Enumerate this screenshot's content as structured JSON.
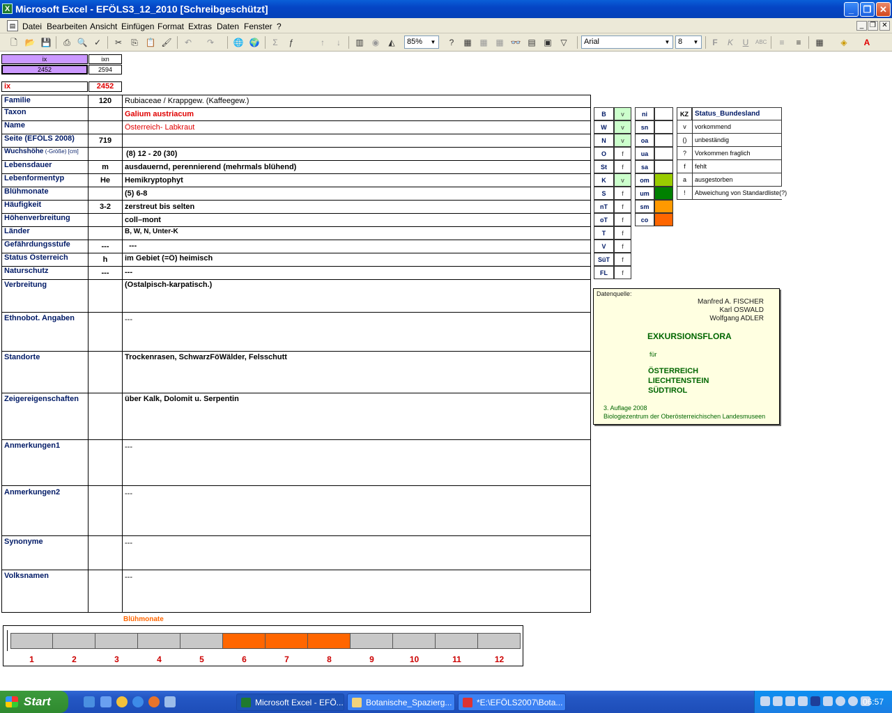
{
  "window": {
    "title": "Microsoft Excel - EFÖLS3_12_2010  [Schreibgeschützt]"
  },
  "menu": [
    "Datei",
    "Bearbeiten",
    "Ansicht",
    "Einfügen",
    "Format",
    "Extras",
    "Daten",
    "Fenster",
    "?"
  ],
  "toolbar": {
    "zoom": "85%",
    "font": "Arial",
    "size": "8"
  },
  "header_cells": {
    "ix_label": "ix",
    "ixn_label": "ixn",
    "ix_value": "2452",
    "ixn_value": "2594",
    "ix_big_label": "ix",
    "ix_big_value": "2452"
  },
  "rows": {
    "familie": {
      "label": "Familie",
      "code": "120",
      "value": "Rubiaceae  /  Krappgew. (Kaffeegew.)"
    },
    "taxon": {
      "label": "Taxon",
      "code": "",
      "value": "Galium austriacum"
    },
    "name": {
      "label": "Name",
      "code": "",
      "value": "Österreich- Labkraut"
    },
    "seite": {
      "label": "Seite (EFÖLS 2008)",
      "code": "719",
      "value": ""
    },
    "wuchshoehe": {
      "label": "Wuchshöhe",
      "label_sub": " (-Größe) [cm]",
      "code": "",
      "value": "(8) 12 - 20 (30)"
    },
    "lebensdauer": {
      "label": "Lebensdauer",
      "code": "m",
      "value": "ausdauernd, perennierend (mehrmals blühend)"
    },
    "lebensform": {
      "label": "Lebenformentyp",
      "code": "He",
      "value": "Hemikryptophyt"
    },
    "bluehmonate": {
      "label": "Blühmonate",
      "code": "",
      "value": "(5) 6-8"
    },
    "haeufigkeit": {
      "label": "Häufigkeit",
      "code": "3-2",
      "value": "zerstreut bis selten"
    },
    "hoehen": {
      "label": "Höhenverbreitung",
      "code": "",
      "value": "coll–mont"
    },
    "laender": {
      "label": "Länder",
      "code": "",
      "value": "B, W, N, Unter-K"
    },
    "gefaehrdung": {
      "label": "Gefährdungsstufe",
      "code": "---",
      "value": "  ---"
    },
    "status": {
      "label": "Status Österreich",
      "code": "h",
      "value": "im Gebiet (=Ö) heimisch"
    },
    "naturschutz": {
      "label": "Naturschutz",
      "code": "---",
      "value": "---"
    },
    "verbreitung": {
      "label": "Verbreitung",
      "value": "(Ostalpisch-karpatisch.)"
    },
    "ethnobot": {
      "label": "Ethnobot. Angaben",
      "value": "---"
    },
    "standorte": {
      "label": "Standorte",
      "value": "Trockenrasen, SchwarzFöWälder, Felsschutt"
    },
    "zeiger": {
      "label": "Zeigereigenschaften",
      "value": "über Kalk, Dolomit u. Serpentin"
    },
    "anm1": {
      "label": "Anmerkungen1",
      "value": "---"
    },
    "anm2": {
      "label": "Anmerkungen2",
      "value": "---"
    },
    "synonyme": {
      "label": "Synonyme",
      "value": "---"
    },
    "volksnamen": {
      "label": "Volksnamen",
      "value": "---"
    }
  },
  "laender_legend": [
    {
      "k": "B",
      "v": "v"
    },
    {
      "k": "W",
      "v": "v"
    },
    {
      "k": "N",
      "v": "v"
    },
    {
      "k": "O",
      "v": "f"
    },
    {
      "k": "St",
      "v": "f"
    },
    {
      "k": "K",
      "v": "v"
    },
    {
      "k": "S",
      "v": "f"
    },
    {
      "k": "nT",
      "v": "f"
    },
    {
      "k": "oT",
      "v": "f"
    },
    {
      "k": "T",
      "v": "f"
    },
    {
      "k": "V",
      "v": "f"
    },
    {
      "k": "SüT",
      "v": "f"
    },
    {
      "k": "FL",
      "v": "f"
    }
  ],
  "hoehen_legend": [
    {
      "k": "ni",
      "color": ""
    },
    {
      "k": "sn",
      "color": ""
    },
    {
      "k": "oa",
      "color": ""
    },
    {
      "k": "ua",
      "color": ""
    },
    {
      "k": "sa",
      "color": ""
    },
    {
      "k": "om",
      "color": "#99cc00"
    },
    {
      "k": "um",
      "color": "#008000"
    },
    {
      "k": "sm",
      "color": "#ff9900"
    },
    {
      "k": "co",
      "color": "#ff6600"
    }
  ],
  "status_legend": {
    "header_kz": "KZ",
    "header_label": "Status_Bundesland",
    "items": [
      {
        "k": "v",
        "t": "vorkommend"
      },
      {
        "k": "()",
        "t": "unbeständig"
      },
      {
        "k": "?",
        "t": "Vorkommen fraglich"
      },
      {
        "k": "f",
        "t": "fehlt"
      },
      {
        "k": "a",
        "t": "ausgestorben"
      },
      {
        "k": "!",
        "t": "Abweichung von Standardliste(?)"
      }
    ]
  },
  "datenquelle": {
    "label": "Datenquelle:",
    "authors": [
      "Manfred A. FISCHER",
      "Karl OSWALD",
      "Wolfgang ADLER"
    ],
    "title": "EXKURSIONSFLORA",
    "fuer": "für",
    "countries": [
      "ÖSTERREICH",
      "LIECHTENSTEIN",
      "SÜDTIROL"
    ],
    "edition": "3. Auflage 2008",
    "publisher": "Biologiezentrum der Oberösterreichischen Landesmuseen"
  },
  "months": {
    "title": "Blühmonate",
    "labels": [
      "1",
      "2",
      "3",
      "4",
      "5",
      "6",
      "7",
      "8",
      "9",
      "10",
      "11",
      "12"
    ],
    "active": [
      false,
      false,
      false,
      false,
      false,
      true,
      true,
      true,
      false,
      false,
      false,
      false
    ],
    "active_color": "#ff6600"
  },
  "taskbar": {
    "start": "Start",
    "tasks": [
      "Microsoft Excel - EFÖ...",
      "Botanische_Spazierg...",
      "*E:\\EFÖLS2007\\Bota..."
    ],
    "clock": "06:57"
  }
}
